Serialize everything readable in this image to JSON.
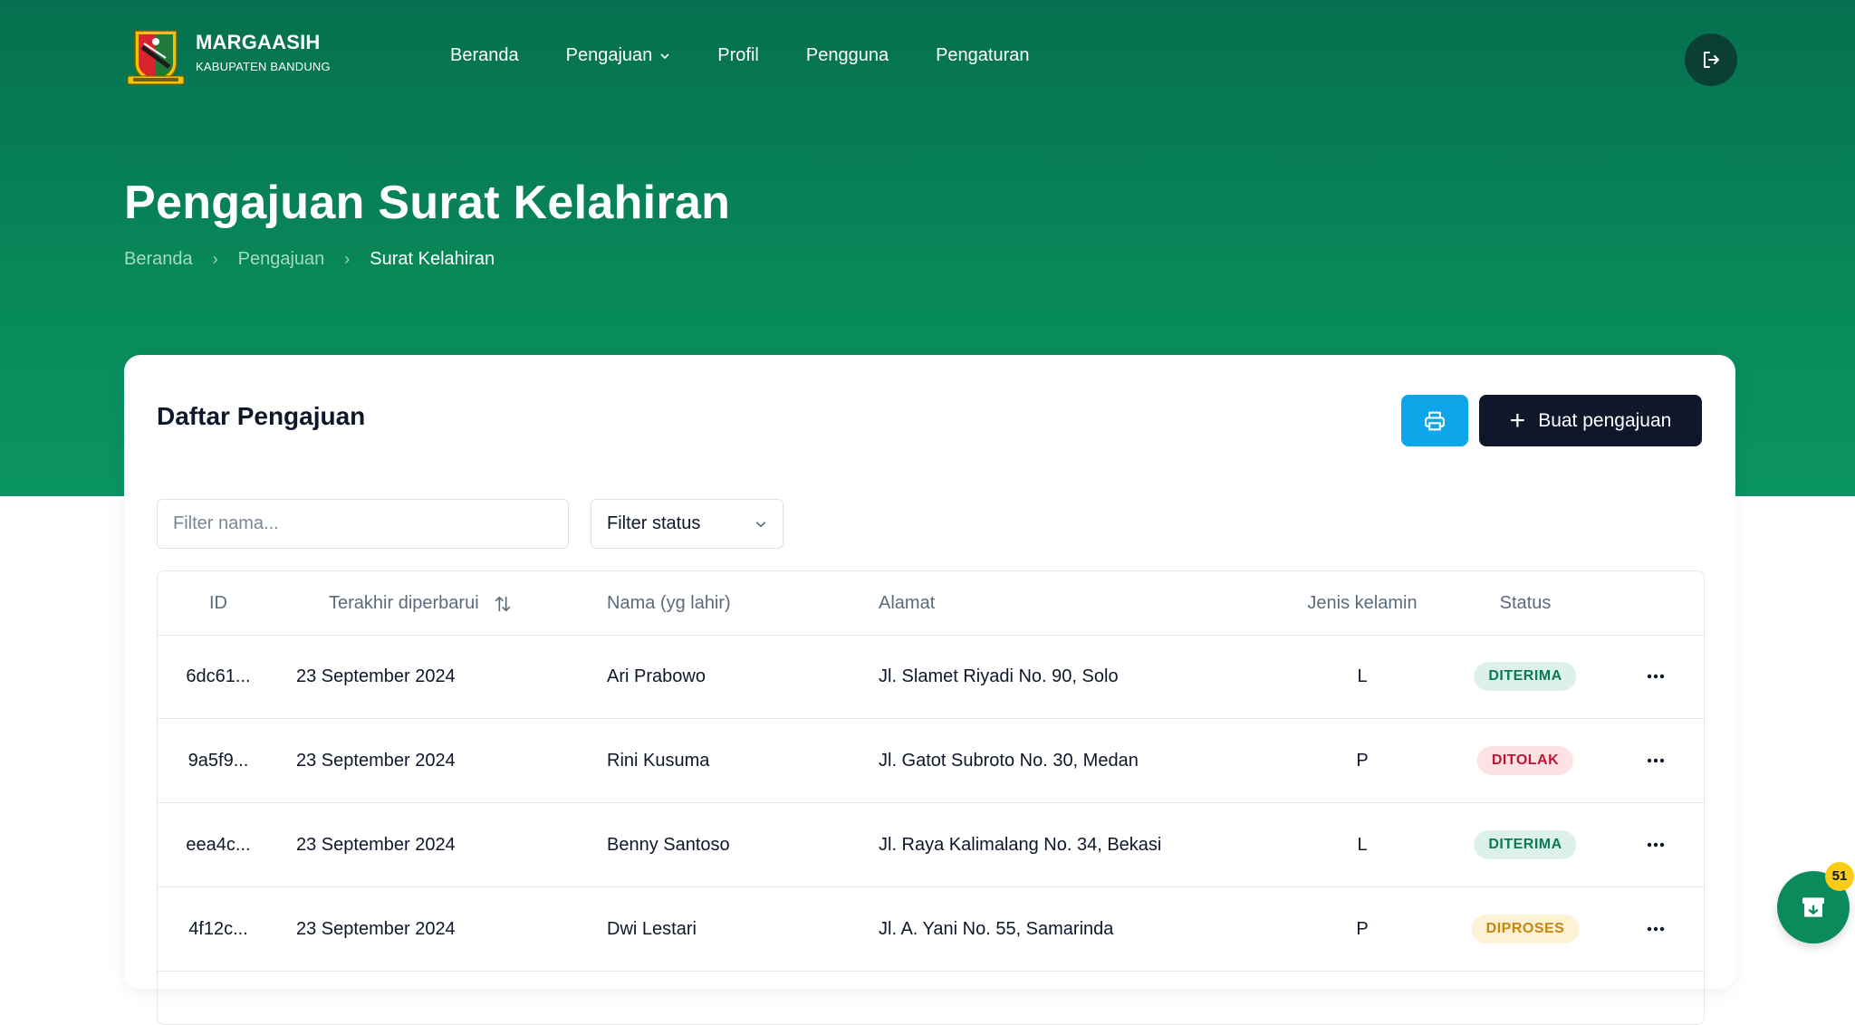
{
  "header": {
    "brand_name": "MARGAASIH",
    "brand_sub": "KABUPATEN BANDUNG",
    "nav": [
      {
        "label": "Beranda"
      },
      {
        "label": "Pengajuan"
      },
      {
        "label": "Profil"
      },
      {
        "label": "Pengguna"
      },
      {
        "label": "Pengaturan"
      }
    ]
  },
  "page": {
    "title": "Pengajuan Surat Kelahiran",
    "breadcrumb": [
      "Beranda",
      "Pengajuan",
      "Surat Kelahiran"
    ]
  },
  "card": {
    "title": "Daftar Pengajuan",
    "create_label": "Buat pengajuan",
    "filter_name_placeholder": "Filter nama...",
    "filter_status_label": "Filter status"
  },
  "table": {
    "columns": [
      "ID",
      "Terakhir diperbarui",
      "Nama (yg lahir)",
      "Alamat",
      "Jenis kelamin",
      "Status"
    ],
    "rows": [
      {
        "id": "6dc61...",
        "updated": "23 September 2024",
        "name": "Ari Prabowo",
        "address": "Jl. Slamet Riyadi No. 90, Solo",
        "gender": "L",
        "status": "DITERIMA",
        "status_type": "accepted"
      },
      {
        "id": "9a5f9...",
        "updated": "23 September 2024",
        "name": "Rini Kusuma",
        "address": "Jl. Gatot Subroto No. 30, Medan",
        "gender": "P",
        "status": "DITOLAK",
        "status_type": "rejected"
      },
      {
        "id": "eea4c...",
        "updated": "23 September 2024",
        "name": "Benny Santoso",
        "address": "Jl. Raya Kalimalang No. 34, Bekasi",
        "gender": "L",
        "status": "DITERIMA",
        "status_type": "accepted"
      },
      {
        "id": "4f12c...",
        "updated": "23 September 2024",
        "name": "Dwi Lestari",
        "address": "Jl. A. Yani No. 55, Samarinda",
        "gender": "P",
        "status": "DIPROSES",
        "status_type": "process"
      }
    ]
  },
  "floating": {
    "badge_count": "51"
  },
  "colors": {
    "hero_green": "#088a5a",
    "dark_button": "#0f172a",
    "print_blue": "#0ea5e9",
    "logout_dark": "#0b3f33",
    "accepted": "#0b7a56",
    "rejected": "#c0152f",
    "process": "#c8860d"
  },
  "icons": {
    "logo": "kabupaten-bandung-emblem",
    "logout": "logout-icon",
    "print": "printer-icon",
    "plus": "plus-icon",
    "sort": "sort-icon",
    "more": "more-horizontal-icon",
    "fab": "archive-download-icon",
    "chevron": "chevron-down-icon"
  }
}
